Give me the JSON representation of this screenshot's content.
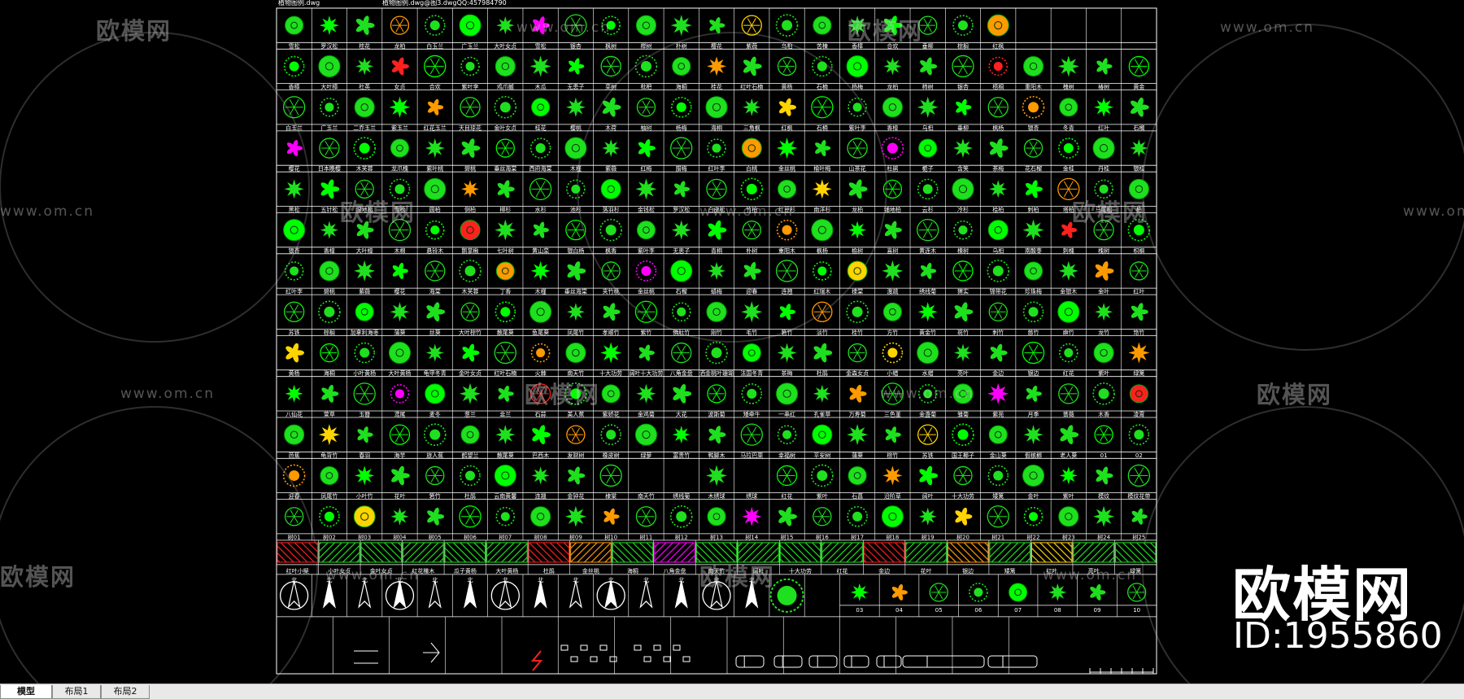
{
  "header_texts": [
    "植物图例.dwg",
    "植物图例.dwg@图3.dwgQQ:457984790"
  ],
  "colors": {
    "background": "#000000",
    "grid": "#ffffff",
    "plant_green": "#1ee01e",
    "plant_bright": "#00ff00",
    "accent_magenta": "#ff00ff",
    "accent_red": "#ff2020",
    "accent_orange": "#ff9a00",
    "accent_yellow": "#ffd400"
  },
  "rows": [
    {
      "labels": [
        "雪松",
        "罗汉松",
        "桂花",
        "龙柏",
        "白玉兰",
        "广玉兰",
        "大叶女贞",
        "雪松",
        "银杏",
        "枫树",
        "榉树",
        "朴树",
        "樱花",
        "紫薇",
        "乌桕",
        "苦楝",
        "香樟",
        "合欢",
        "垂柳",
        "棕榈",
        "红枫",
        "",
        " ",
        "",
        " "
      ]
    },
    {
      "labels": [
        "香樟",
        "大叶樟",
        "杜英",
        "女贞",
        "合欢",
        "紫叶李",
        "鸡爪槭",
        "木瓜",
        "无患子",
        "栾树",
        "枇杷",
        "海桐",
        "桂花",
        "红叶石楠",
        "黄杨",
        "石楠",
        "杨梅",
        "龙柏",
        "柿树",
        "银杏",
        "梧桐",
        "重阳木",
        "槐树",
        "椿树",
        "黄金"
      ]
    },
    {
      "labels": [
        "白玉兰",
        "广玉兰",
        "二乔玉兰",
        "紫玉兰",
        "红花玉兰",
        "天目琼花",
        "金叶女贞",
        "桂花",
        "樱桃",
        "木荷",
        "柚树",
        "杨梅",
        "海桐",
        "三角枫",
        "红枫",
        "石楠",
        "紫叶李",
        "香樟",
        "乌桕",
        "垂柳",
        "枫杨",
        "银杏",
        "冬青",
        "红叶",
        "石榴"
      ]
    },
    {
      "labels": [
        "樱花",
        "日本晚樱",
        "木芙蓉",
        "龙爪槐",
        "紫叶桃",
        "碧桃",
        "垂丝海棠",
        "西府海棠",
        "木槿",
        "紫薇",
        "红梅",
        "腊梅",
        "红叶李",
        "白桃",
        "金丝桃",
        "榆叶梅",
        "山茶花",
        "杜鹃",
        "栀子",
        "含笑",
        "茶梅",
        "花石榴",
        "金桂",
        "丹桂",
        "银桂"
      ]
    },
    {
      "labels": [
        "黑松",
        "五针松",
        "湿地松",
        "雪松",
        "圆柏",
        "侧柏",
        "柳杉",
        "水杉",
        "池杉",
        "落羽杉",
        "金钱松",
        "罗汉松",
        "白皮松",
        "竹柏",
        "红豆杉",
        "南洋杉",
        "龙柏",
        "铺地柏",
        "云杉",
        "冷杉",
        "桧柏",
        "刺柏",
        "塔柏",
        "马尾松",
        "柏"
      ]
    },
    {
      "labels": [
        "银杏",
        "香樟",
        "大叶樟",
        "木棉",
        "悬铃木",
        "鹅掌楸",
        "七叶树",
        "黄山栾",
        "银白杨",
        "枫香",
        "紫叶李",
        "无患子",
        "青桐",
        "朴树",
        "重阳木",
        "枫杨",
        "榆树",
        "喜树",
        "黄连木",
        "楝树",
        "乌桕",
        "南酸枣",
        "刺槐",
        "槐树",
        "枳椇"
      ]
    },
    {
      "labels": [
        "红叶李",
        "碧桃",
        "紫薇",
        "樱花",
        "海棠",
        "木芙蓉",
        "丁香",
        "木槿",
        "垂丝海棠",
        "夹竹桃",
        "金丝桃",
        "石榴",
        "蜡梅",
        "迎春",
        "连翘",
        "红瑞木",
        "棣棠",
        "溲疏",
        "绣线菊",
        "猬实",
        "锦带花",
        "珍珠梅",
        "金银木",
        "金叶",
        "红叶"
      ]
    },
    {
      "labels": [
        "苏铁",
        "棕榈",
        "加拿利海枣",
        "蒲葵",
        "丝葵",
        "大叶棕竹",
        "散尾葵",
        "鱼尾葵",
        "凤尾竹",
        "孝顺竹",
        "紫竹",
        "佛肚竹",
        "刚竹",
        "毛竹",
        "箬竹",
        "淡竹",
        "桂竹",
        "方竹",
        "黄金竹",
        "斑竹",
        "刺竹",
        "慈竹",
        "麻竹",
        "龙竹",
        "筇竹"
      ]
    },
    {
      "labels": [
        "黄杨",
        "海桐",
        "小叶黄杨",
        "大叶黄杨",
        "龟甲冬青",
        "金叶女贞",
        "红叶石楠",
        "火棘",
        "南天竹",
        "十大功劳",
        "阔叶十大功劳",
        "八角金盘",
        "洒金桃叶珊瑚",
        "法国冬青",
        "茶梅",
        "杜鹃",
        "金森女贞",
        "小蜡",
        "水蜡",
        "亮叶",
        "金边",
        "银边",
        "红花",
        "紫叶",
        "绿篱"
      ]
    },
    {
      "labels": [
        "八仙花",
        "萱草",
        "玉簪",
        "鸢尾",
        "麦冬",
        "葱兰",
        "韭兰",
        "石蒜",
        "美人蕉",
        "紫娇花",
        "金鸡菊",
        "大花",
        "波斯菊",
        "矮牵牛",
        "一串红",
        "孔雀草",
        "万寿菊",
        "三色堇",
        "金盏菊",
        "雏菊",
        "紫苑",
        "月季",
        "蔷薇",
        "木香",
        "凌霄"
      ]
    },
    {
      "labels": [
        "芭蕉",
        "龟背竹",
        "春羽",
        "海芋",
        "旅人蕉",
        "鹤望兰",
        "散尾葵",
        "巴西木",
        "发财树",
        "橡皮树",
        "绿萝",
        "富贵竹",
        "鸭脚木",
        "马拉巴栗",
        "幸福树",
        "平安树",
        "蒲葵",
        "棕竹",
        "苏铁",
        "国王椰子",
        "金山葵",
        "假槟榔",
        "老人葵",
        "01",
        "02"
      ]
    },
    {
      "labels": [
        "迎春",
        "凤尾竹",
        "小叶竹",
        "花叶",
        "箬竹",
        "杜鹃",
        "云南黄馨",
        "连翘",
        "金钟花",
        "棣棠",
        "南天竹",
        "绣线菊",
        "木绣球",
        "绣球",
        "红花",
        "紫叶",
        "石菖",
        "沿阶草",
        "阔叶",
        "十大功劳",
        "矮篱",
        "金叶",
        "紫叶",
        "模纹",
        "模纹花带"
      ]
    },
    {
      "labels": [
        "树01",
        "树02",
        "树03",
        "树04",
        "树05",
        "树06",
        "树07",
        "树08",
        "树09",
        "树10",
        "树11",
        "树12",
        "树13",
        "树14",
        "树15",
        "树16",
        "树17",
        "树18",
        "树19",
        "树20",
        "树21",
        "树22",
        "树23",
        "树24",
        "树25"
      ]
    }
  ],
  "hatch_labels": [
    "红叶小檗",
    "小叶女贞",
    "金叶女贞",
    "红花檵木",
    "瓜子黄杨",
    "大叶黄杨",
    "杜鹃",
    "金丝桃",
    "海桐",
    "八角金盘",
    "南天竹",
    "阔叶",
    "十大功劳",
    "红花",
    "金边",
    "花叶",
    "银边",
    "矮篱",
    "红叶",
    "亮叶",
    "绿篱"
  ],
  "shrub_labels": [
    "03",
    "04",
    "05",
    "06",
    "07",
    "08",
    "09",
    "10"
  ],
  "north_label": "北",
  "brand": {
    "cn": "欧模网",
    "id": "ID:1955860"
  },
  "watermarks": {
    "brand": "欧模网",
    "url": "www.om.cn"
  },
  "tabs": [
    {
      "label": "模型",
      "active": true
    },
    {
      "label": "布局1",
      "active": false
    },
    {
      "label": "布局2",
      "active": false
    }
  ]
}
